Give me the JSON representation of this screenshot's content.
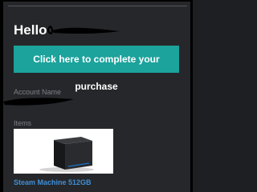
{
  "email": {
    "greeting": "Hello",
    "cta_label": "Click here to complete your purchase",
    "account_name_label": "Account Name",
    "items_label": "Items",
    "product": {
      "name": "Steam Machine 512GB",
      "image_icon": "console-box-image"
    }
  },
  "colors": {
    "background": "#26272a",
    "cta": "#1ba39c",
    "link": "#3f8fd6",
    "label": "#7c7f86"
  }
}
